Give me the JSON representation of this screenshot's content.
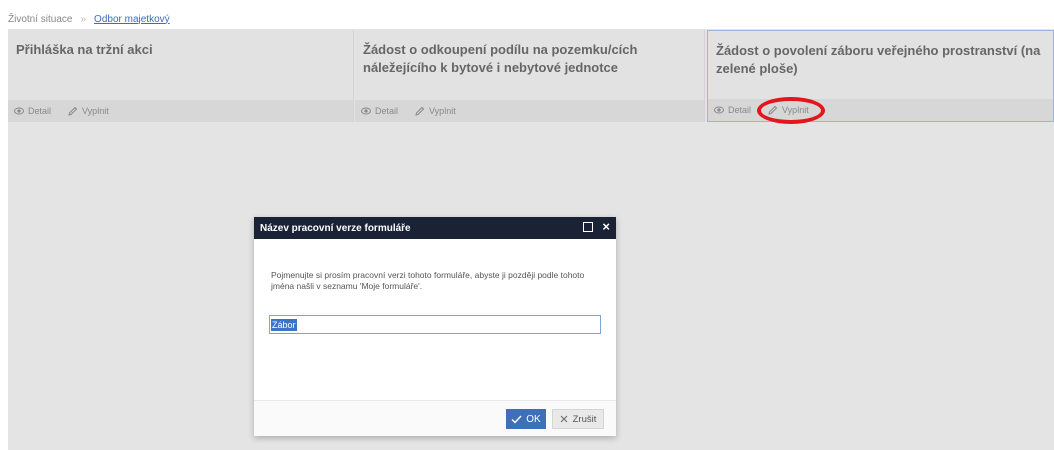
{
  "breadcrumb": {
    "root": "Životní situace",
    "separator": "»",
    "current": "Odbor majetkový"
  },
  "cards": [
    {
      "title": "Přihláška na tržní akci",
      "detail_label": "Detail",
      "fill_label": "Vyplnit"
    },
    {
      "title": "Žádost o odkoupení podílu na pozemku/cích náležejícího k bytové i nebytové jednotce",
      "detail_label": "Detail",
      "fill_label": "Vyplnit"
    },
    {
      "title": "Žádost o povolení záboru veřejného prostranství (na zelené ploše)",
      "detail_label": "Detail",
      "fill_label": "Vyplnit"
    }
  ],
  "dialog": {
    "title": "Název pracovní verze formuláře",
    "message": "Pojmenujte si prosím pracovní verzi tohoto formuláře, abyste ji později podle tohoto jména našli v seznamu 'Moje formuláře'.",
    "input_value": "Zábor",
    "ok_label": "OK",
    "cancel_label": "Zrušit"
  },
  "colors": {
    "dialog_header": "#1a2336",
    "primary_button": "#3e70b8",
    "annotation": "#e2161b"
  },
  "icons": {
    "detail": "eye-icon",
    "fill": "pencil-icon",
    "ok": "check-icon",
    "cancel": "x-icon",
    "maximize": "maximize-icon",
    "close": "close-icon"
  }
}
